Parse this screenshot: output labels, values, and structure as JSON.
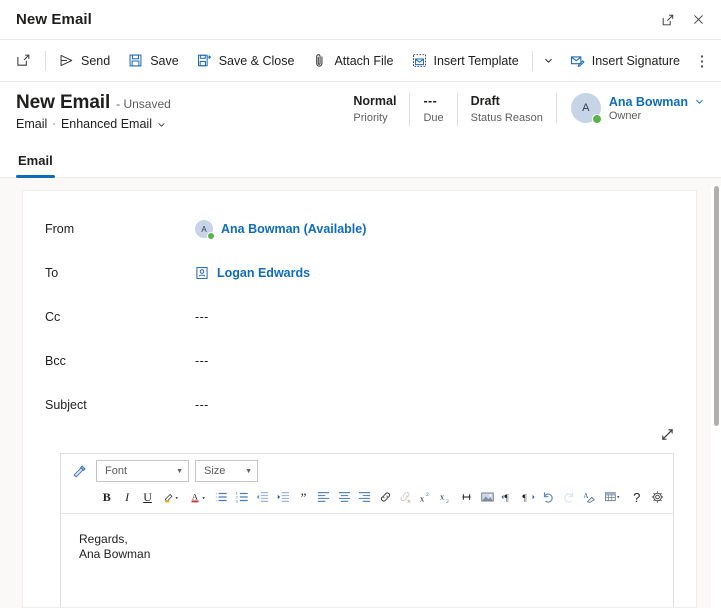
{
  "window": {
    "title": "New Email",
    "popout_icon": "popout-icon",
    "close_icon": "close-icon"
  },
  "commandbar": {
    "new_icon": "new-window-icon",
    "items": [
      {
        "label": "Send",
        "icon": "send-icon"
      },
      {
        "label": "Save",
        "icon": "save-icon"
      },
      {
        "label": "Save & Close",
        "icon": "save-and-close-icon"
      },
      {
        "label": "Attach File",
        "icon": "paperclip-icon"
      },
      {
        "label": "Insert Template",
        "icon": "insert-template-icon"
      },
      {
        "label": "Insert Signature",
        "icon": "insert-signature-icon"
      }
    ],
    "template_caret": "chevron-down-icon",
    "overflow_label": "⋮"
  },
  "record_header": {
    "title": "New Email",
    "state": "- Unsaved",
    "entity": "Email",
    "separator": "·",
    "form_name": "Enhanced Email",
    "form_caret": "chevron-down-icon",
    "fields": [
      {
        "value": "Normal",
        "label": "Priority"
      },
      {
        "value": "---",
        "label": "Due"
      },
      {
        "value": "Draft",
        "label": "Status Reason"
      }
    ],
    "owner": {
      "initial": "A",
      "name": "Ana Bowman",
      "role": "Owner",
      "caret": "chevron-down-icon",
      "presence": "available"
    }
  },
  "tabs": [
    {
      "label": "Email",
      "active": true
    }
  ],
  "form": {
    "rows": [
      {
        "label": "From",
        "type": "person",
        "initial": "A",
        "value": "Ana Bowman (Available)"
      },
      {
        "label": "To",
        "type": "lookup",
        "icon": "contact-card-icon",
        "value": "Logan Edwards"
      },
      {
        "label": "Cc",
        "type": "empty",
        "value": "---"
      },
      {
        "label": "Bcc",
        "type": "empty",
        "value": "---"
      },
      {
        "label": "Subject",
        "type": "empty",
        "value": "---"
      }
    ]
  },
  "editor": {
    "expand_icon": "expand-diagonal-icon",
    "format_painter_icon": "format-painter-icon",
    "font_select": {
      "value": "Font",
      "caret": "chevron-down-icon"
    },
    "size_select": {
      "value": "Size",
      "caret": "chevron-down-icon"
    },
    "tools": [
      {
        "name": "bold-icon",
        "glyph": "B",
        "kind": "text-bold"
      },
      {
        "name": "italic-icon",
        "glyph": "I",
        "kind": "text-italic"
      },
      {
        "name": "underline-icon",
        "glyph": "U",
        "kind": "text-underline"
      },
      {
        "name": "highlight-color-icon",
        "kind": "highlight"
      },
      {
        "name": "font-color-icon",
        "kind": "fontcolor"
      },
      {
        "name": "bulleted-list-icon",
        "kind": "bullets"
      },
      {
        "name": "numbered-list-icon",
        "kind": "numbers"
      },
      {
        "name": "decrease-indent-icon",
        "kind": "outdent"
      },
      {
        "name": "increase-indent-icon",
        "kind": "indent"
      },
      {
        "name": "blockquote-icon",
        "kind": "quote"
      },
      {
        "name": "align-left-icon",
        "kind": "align-left"
      },
      {
        "name": "align-center-icon",
        "kind": "align-center"
      },
      {
        "name": "align-right-icon",
        "kind": "align-right"
      },
      {
        "name": "insert-link-icon",
        "kind": "link"
      },
      {
        "name": "remove-link-icon",
        "kind": "unlink",
        "disabled": true
      },
      {
        "name": "superscript-icon",
        "kind": "superscript"
      },
      {
        "name": "subscript-icon",
        "kind": "subscript"
      },
      {
        "name": "strikethrough-icon",
        "kind": "strikethrough"
      },
      {
        "name": "insert-image-icon",
        "kind": "image"
      },
      {
        "name": "left-to-right-icon",
        "kind": "ltr"
      },
      {
        "name": "right-to-left-icon",
        "kind": "rtl"
      },
      {
        "name": "undo-icon",
        "kind": "undo"
      },
      {
        "name": "redo-icon",
        "kind": "redo",
        "disabled": true
      },
      {
        "name": "clear-formatting-icon",
        "kind": "clearformat"
      },
      {
        "name": "insert-table-icon",
        "kind": "table"
      },
      {
        "name": "help-icon",
        "glyph": "?",
        "kind": "help"
      },
      {
        "name": "editor-settings-icon",
        "kind": "settings"
      }
    ],
    "body_lines": [
      "Regards,",
      "Ana Bowman"
    ]
  },
  "colors": {
    "accent": "#0f6cbd",
    "canvas_bg": "#faf9f8",
    "card_bg": "#ffffff",
    "border": "#e1dfdd",
    "presence_available": "#5ab34a",
    "text_primary": "#201f1e",
    "text_secondary": "#605e5c"
  }
}
